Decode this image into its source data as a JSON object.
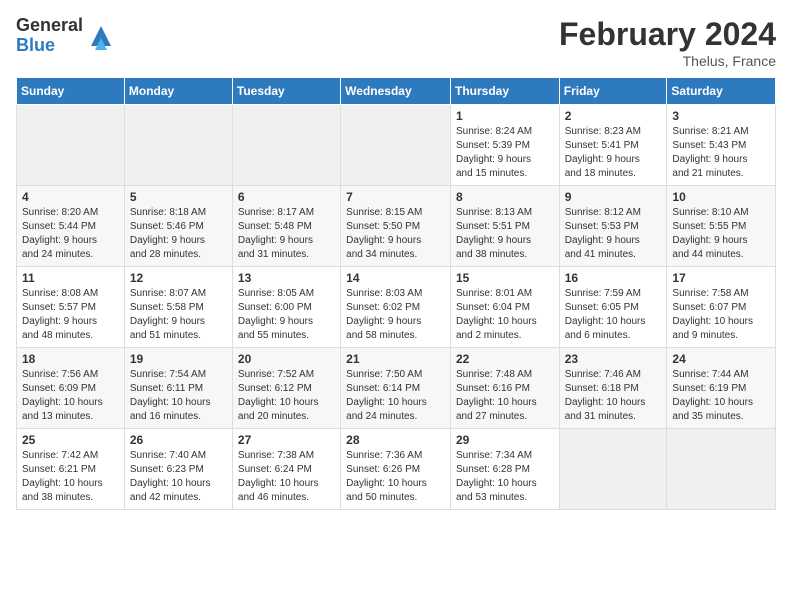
{
  "logo": {
    "general": "General",
    "blue": "Blue"
  },
  "title": "February 2024",
  "location": "Thelus, France",
  "days_header": [
    "Sunday",
    "Monday",
    "Tuesday",
    "Wednesday",
    "Thursday",
    "Friday",
    "Saturday"
  ],
  "weeks": [
    [
      {
        "day": "",
        "info": ""
      },
      {
        "day": "",
        "info": ""
      },
      {
        "day": "",
        "info": ""
      },
      {
        "day": "",
        "info": ""
      },
      {
        "day": "1",
        "info": "Sunrise: 8:24 AM\nSunset: 5:39 PM\nDaylight: 9 hours\nand 15 minutes."
      },
      {
        "day": "2",
        "info": "Sunrise: 8:23 AM\nSunset: 5:41 PM\nDaylight: 9 hours\nand 18 minutes."
      },
      {
        "day": "3",
        "info": "Sunrise: 8:21 AM\nSunset: 5:43 PM\nDaylight: 9 hours\nand 21 minutes."
      }
    ],
    [
      {
        "day": "4",
        "info": "Sunrise: 8:20 AM\nSunset: 5:44 PM\nDaylight: 9 hours\nand 24 minutes."
      },
      {
        "day": "5",
        "info": "Sunrise: 8:18 AM\nSunset: 5:46 PM\nDaylight: 9 hours\nand 28 minutes."
      },
      {
        "day": "6",
        "info": "Sunrise: 8:17 AM\nSunset: 5:48 PM\nDaylight: 9 hours\nand 31 minutes."
      },
      {
        "day": "7",
        "info": "Sunrise: 8:15 AM\nSunset: 5:50 PM\nDaylight: 9 hours\nand 34 minutes."
      },
      {
        "day": "8",
        "info": "Sunrise: 8:13 AM\nSunset: 5:51 PM\nDaylight: 9 hours\nand 38 minutes."
      },
      {
        "day": "9",
        "info": "Sunrise: 8:12 AM\nSunset: 5:53 PM\nDaylight: 9 hours\nand 41 minutes."
      },
      {
        "day": "10",
        "info": "Sunrise: 8:10 AM\nSunset: 5:55 PM\nDaylight: 9 hours\nand 44 minutes."
      }
    ],
    [
      {
        "day": "11",
        "info": "Sunrise: 8:08 AM\nSunset: 5:57 PM\nDaylight: 9 hours\nand 48 minutes."
      },
      {
        "day": "12",
        "info": "Sunrise: 8:07 AM\nSunset: 5:58 PM\nDaylight: 9 hours\nand 51 minutes."
      },
      {
        "day": "13",
        "info": "Sunrise: 8:05 AM\nSunset: 6:00 PM\nDaylight: 9 hours\nand 55 minutes."
      },
      {
        "day": "14",
        "info": "Sunrise: 8:03 AM\nSunset: 6:02 PM\nDaylight: 9 hours\nand 58 minutes."
      },
      {
        "day": "15",
        "info": "Sunrise: 8:01 AM\nSunset: 6:04 PM\nDaylight: 10 hours\nand 2 minutes."
      },
      {
        "day": "16",
        "info": "Sunrise: 7:59 AM\nSunset: 6:05 PM\nDaylight: 10 hours\nand 6 minutes."
      },
      {
        "day": "17",
        "info": "Sunrise: 7:58 AM\nSunset: 6:07 PM\nDaylight: 10 hours\nand 9 minutes."
      }
    ],
    [
      {
        "day": "18",
        "info": "Sunrise: 7:56 AM\nSunset: 6:09 PM\nDaylight: 10 hours\nand 13 minutes."
      },
      {
        "day": "19",
        "info": "Sunrise: 7:54 AM\nSunset: 6:11 PM\nDaylight: 10 hours\nand 16 minutes."
      },
      {
        "day": "20",
        "info": "Sunrise: 7:52 AM\nSunset: 6:12 PM\nDaylight: 10 hours\nand 20 minutes."
      },
      {
        "day": "21",
        "info": "Sunrise: 7:50 AM\nSunset: 6:14 PM\nDaylight: 10 hours\nand 24 minutes."
      },
      {
        "day": "22",
        "info": "Sunrise: 7:48 AM\nSunset: 6:16 PM\nDaylight: 10 hours\nand 27 minutes."
      },
      {
        "day": "23",
        "info": "Sunrise: 7:46 AM\nSunset: 6:18 PM\nDaylight: 10 hours\nand 31 minutes."
      },
      {
        "day": "24",
        "info": "Sunrise: 7:44 AM\nSunset: 6:19 PM\nDaylight: 10 hours\nand 35 minutes."
      }
    ],
    [
      {
        "day": "25",
        "info": "Sunrise: 7:42 AM\nSunset: 6:21 PM\nDaylight: 10 hours\nand 38 minutes."
      },
      {
        "day": "26",
        "info": "Sunrise: 7:40 AM\nSunset: 6:23 PM\nDaylight: 10 hours\nand 42 minutes."
      },
      {
        "day": "27",
        "info": "Sunrise: 7:38 AM\nSunset: 6:24 PM\nDaylight: 10 hours\nand 46 minutes."
      },
      {
        "day": "28",
        "info": "Sunrise: 7:36 AM\nSunset: 6:26 PM\nDaylight: 10 hours\nand 50 minutes."
      },
      {
        "day": "29",
        "info": "Sunrise: 7:34 AM\nSunset: 6:28 PM\nDaylight: 10 hours\nand 53 minutes."
      },
      {
        "day": "",
        "info": ""
      },
      {
        "day": "",
        "info": ""
      }
    ]
  ]
}
